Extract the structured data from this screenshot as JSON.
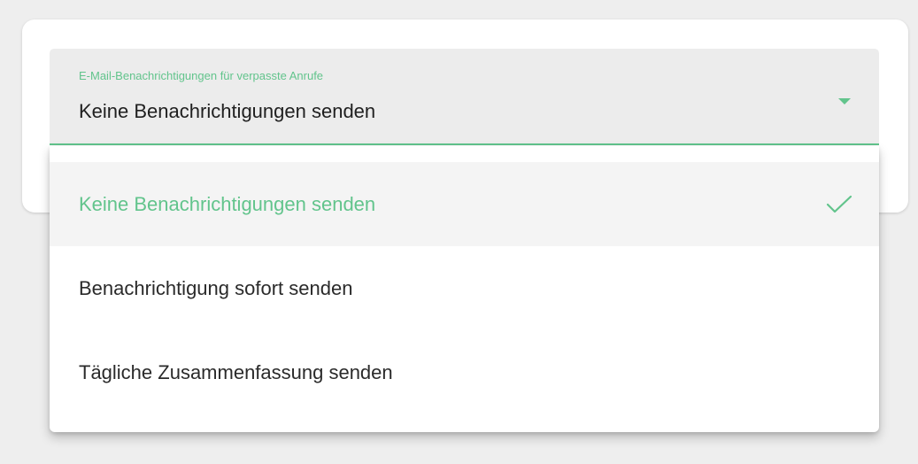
{
  "select": {
    "label": "E-Mail-Benachrichtigungen für verpasste Anrufe",
    "value": "Keine Benachrichtigungen senden"
  },
  "menu": {
    "options": [
      {
        "label": "Keine Benachrichtigungen senden",
        "selected": true
      },
      {
        "label": "Benachrichtigung sofort senden",
        "selected": false
      },
      {
        "label": "Tägliche Zusammenfassung senden",
        "selected": false
      }
    ]
  },
  "icons": {
    "dropdown": "triangle-down-icon",
    "selected": "checkmark-icon"
  },
  "colors": {
    "accent": "#62c48c",
    "field_background": "#ececec",
    "page_background": "#eeeeee",
    "text": "#202020"
  }
}
